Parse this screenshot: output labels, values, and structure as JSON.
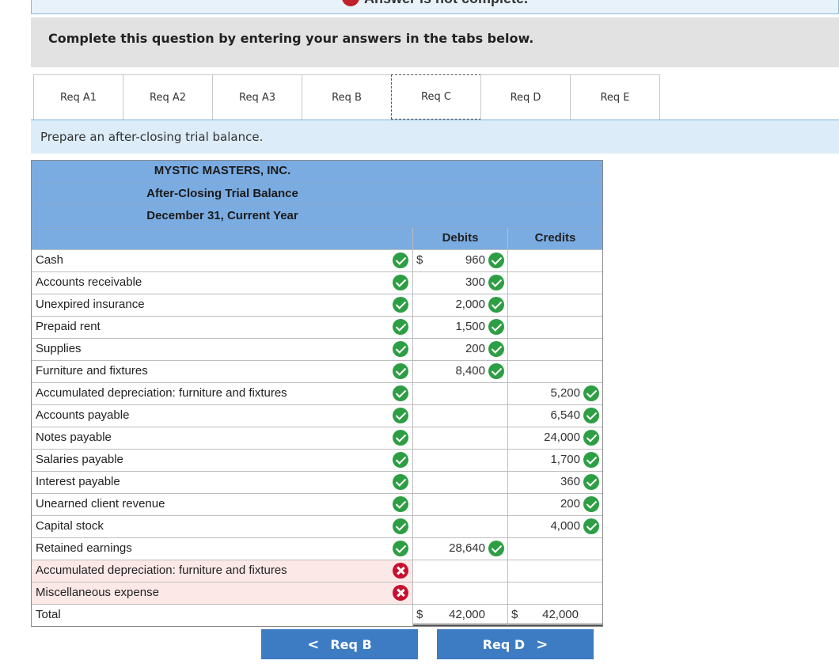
{
  "banner": {
    "text": "Answer is not complete."
  },
  "instructions": "Complete this question by entering your answers in the tabs below.",
  "tabs": [
    "Req A1",
    "Req A2",
    "Req A3",
    "Req B",
    "Req C",
    "Req D",
    "Req E"
  ],
  "active_tab": "Req C",
  "prompt": "Prepare an after-closing trial balance.",
  "statement": {
    "company": "MYSTIC MASTERS, INC.",
    "title": "After-Closing Trial Balance",
    "date": "December 31, Current Year",
    "debits_label": "Debits",
    "credits_label": "Credits",
    "rows": [
      {
        "name": "Cash",
        "status": "correct",
        "debit_dollar": "$",
        "debit": "960",
        "credit": ""
      },
      {
        "name": "Accounts receivable",
        "status": "correct",
        "debit": "300",
        "credit": ""
      },
      {
        "name": "Unexpired insurance",
        "status": "correct",
        "debit": "2,000",
        "credit": ""
      },
      {
        "name": "Prepaid rent",
        "status": "correct",
        "debit": "1,500",
        "credit": ""
      },
      {
        "name": "Supplies",
        "status": "correct",
        "debit": "200",
        "credit": ""
      },
      {
        "name": "Furniture and fixtures",
        "status": "correct",
        "debit": "8,400",
        "credit": ""
      },
      {
        "name": "Accumulated depreciation: furniture and fixtures",
        "status": "correct",
        "debit": "",
        "credit": "5,200"
      },
      {
        "name": "Accounts payable",
        "status": "correct",
        "debit": "",
        "credit": "6,540"
      },
      {
        "name": "Notes payable",
        "status": "correct",
        "debit": "",
        "credit": "24,000"
      },
      {
        "name": "Salaries payable",
        "status": "correct",
        "debit": "",
        "credit": "1,700"
      },
      {
        "name": "Interest payable",
        "status": "correct",
        "debit": "",
        "credit": "360"
      },
      {
        "name": "Unearned client revenue",
        "status": "correct",
        "debit": "",
        "credit": "200"
      },
      {
        "name": "Capital stock",
        "status": "correct",
        "debit": "",
        "credit": "4,000"
      },
      {
        "name": "Retained earnings",
        "status": "correct",
        "debit": "28,640",
        "credit": ""
      },
      {
        "name": "Accumulated depreciation: furniture and fixtures",
        "status": "incorrect",
        "debit": "",
        "credit": ""
      },
      {
        "name": "Miscellaneous expense",
        "status": "incorrect",
        "debit": "",
        "credit": ""
      }
    ],
    "total": {
      "label": "Total",
      "debit_dollar": "$",
      "debit": "42,000",
      "credit_dollar": "$",
      "credit": "42,000"
    }
  },
  "nav": {
    "prev_label": "Req B",
    "next_label": "Req D",
    "prev_chevron": "<",
    "next_chevron": ">"
  },
  "colors": {
    "header_blue": "#7aace2",
    "button_blue": "#3d7cc2",
    "correct_green": "#2e9e45",
    "incorrect_red": "#c8102e"
  }
}
